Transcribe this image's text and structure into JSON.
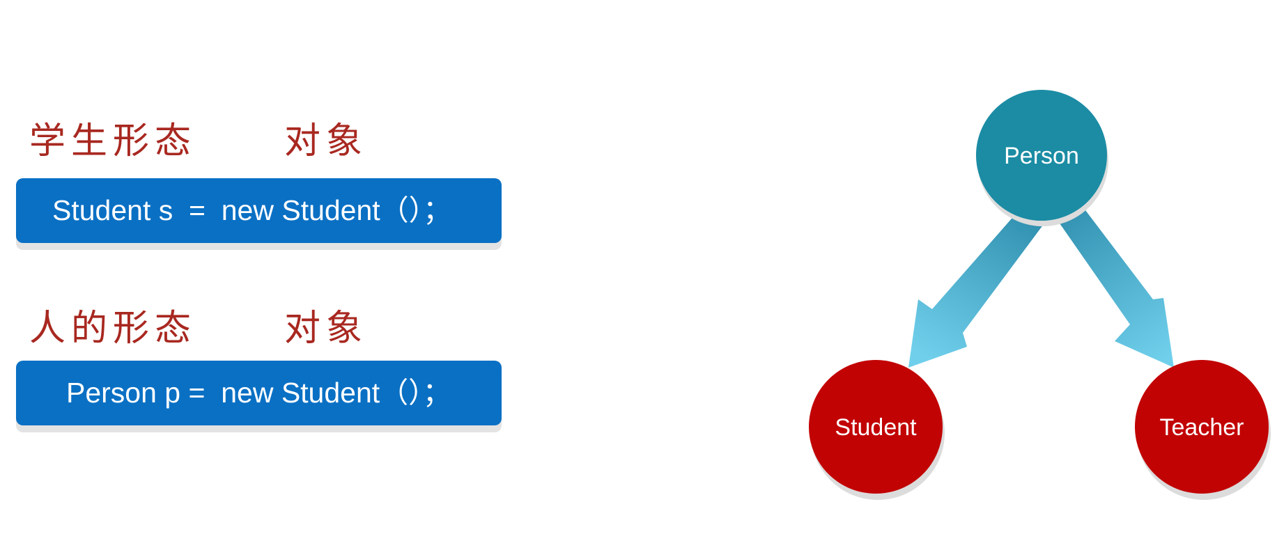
{
  "left_panel": {
    "examples": [
      {
        "caption_form": "学生形态",
        "caption_object": "对象",
        "code": "Student s  =  new Student（）；"
      },
      {
        "caption_form": "人的形态",
        "caption_object": "对象",
        "code": "Person p =  new Student（）；"
      }
    ]
  },
  "hierarchy": {
    "parent": {
      "label": "Person",
      "color": "#1b8ca4"
    },
    "children": [
      {
        "label": "Student",
        "color": "#c20303"
      },
      {
        "label": "Teacher",
        "color": "#c20303"
      }
    ],
    "arrow_color": "#5cc6e4"
  }
}
